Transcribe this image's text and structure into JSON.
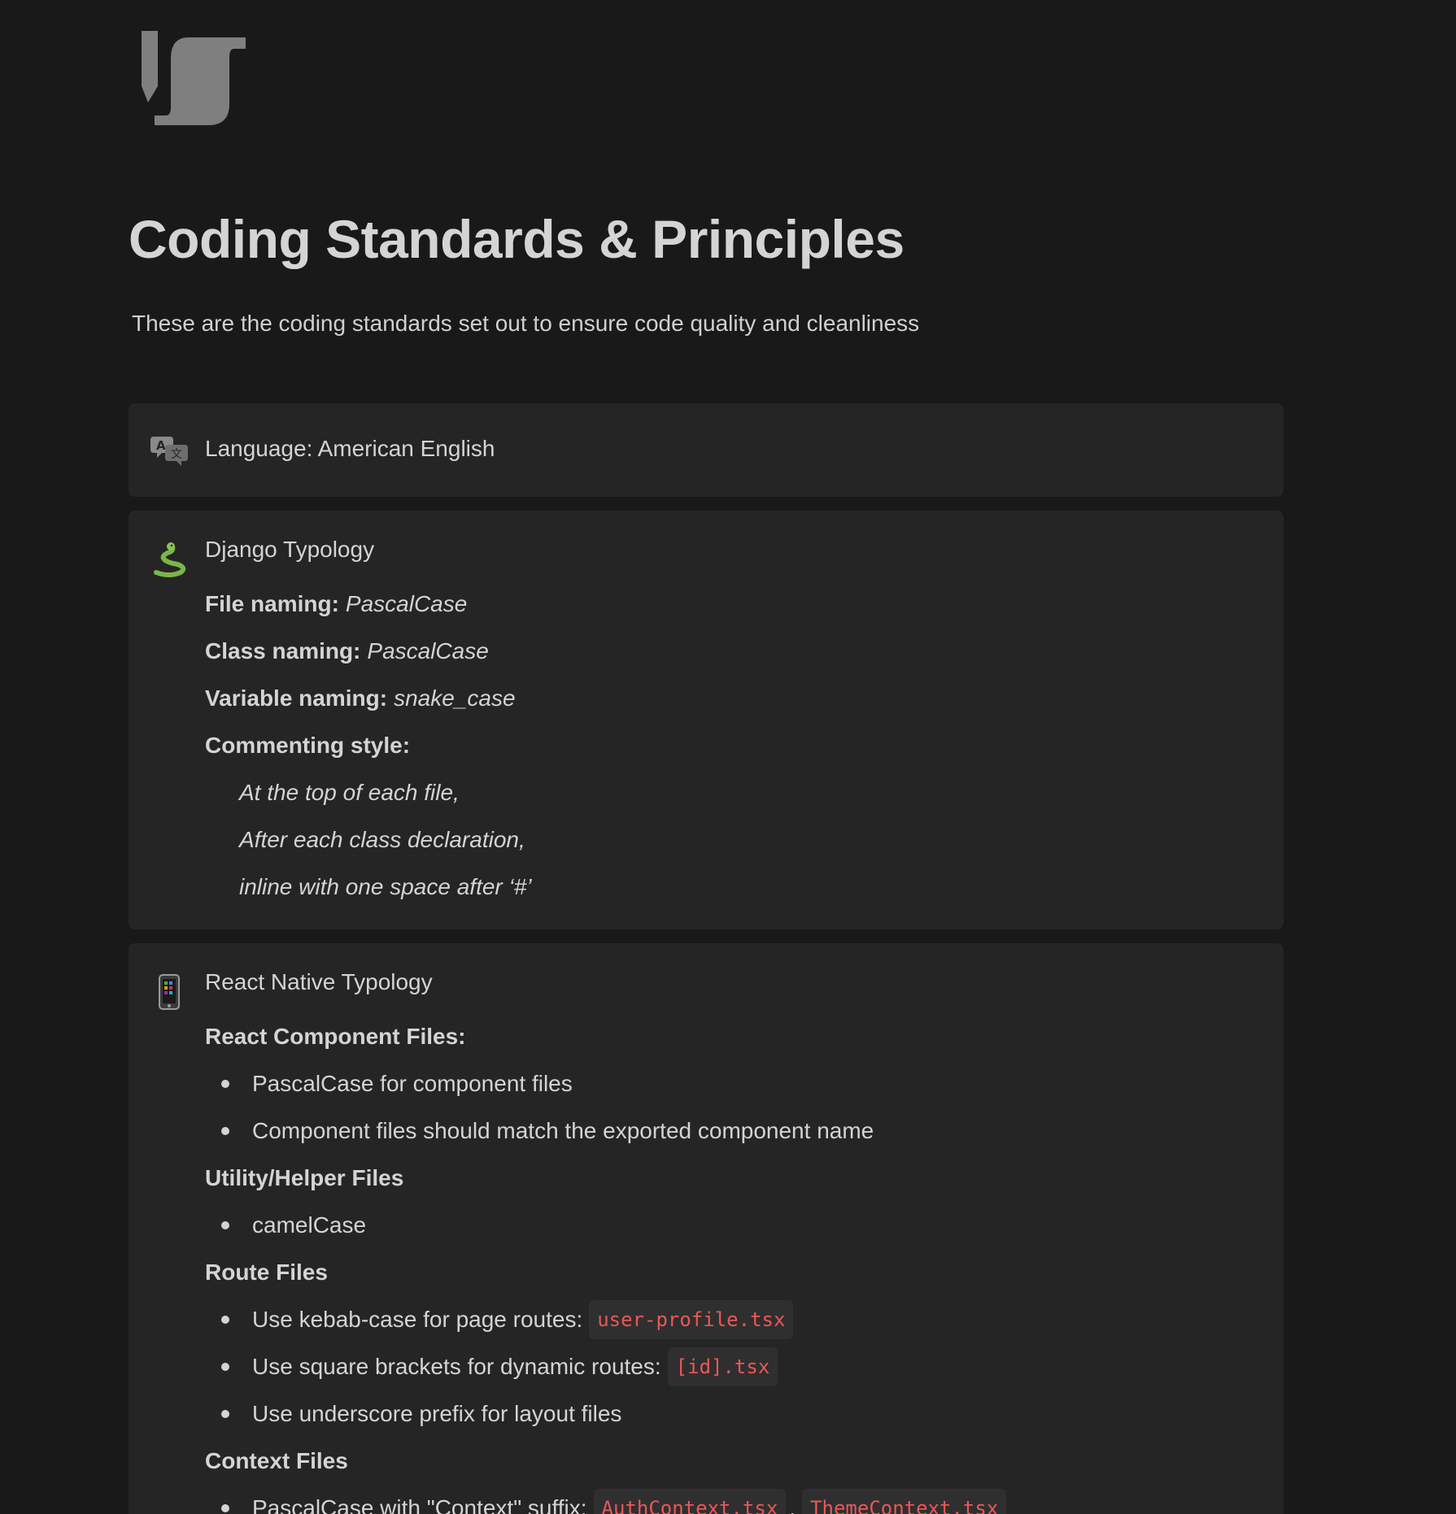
{
  "page": {
    "title": "Coding Standards & Principles",
    "subtitle": "These are the coding standards set out to ensure code quality and cleanliness"
  },
  "callouts": {
    "language": {
      "icon": "translate-icon",
      "text": "Language: American English"
    },
    "django": {
      "icon": "snake-icon",
      "title": "Django Typology",
      "rows": [
        {
          "label": "File naming:",
          "value": "PascalCase"
        },
        {
          "label": "Class naming:",
          "value": "PascalCase"
        },
        {
          "label": "Variable naming:",
          "value": "snake_case"
        },
        {
          "label": "Commenting style:",
          "value": ""
        }
      ],
      "comment_items": [
        "At the top of each file,",
        "After each class declaration,",
        "inline with one space after ‘#’"
      ]
    },
    "react_native": {
      "icon": "mobile-phone-icon",
      "title": "React Native Typology",
      "sections": {
        "components": {
          "heading": "React Component Files:",
          "items": [
            "PascalCase for component files",
            "Component files should match the exported component name"
          ]
        },
        "utility": {
          "heading": "Utility/Helper Files",
          "items": [
            "camelCase"
          ]
        },
        "routes": {
          "heading": "Route Files",
          "items": [
            {
              "text": "Use kebab-case for page routes:",
              "code": "user-profile.tsx"
            },
            {
              "text": "Use square brackets for dynamic routes:",
              "code": "[id].tsx"
            },
            {
              "text": "Use underscore prefix for layout files",
              "code": ""
            }
          ]
        },
        "context": {
          "heading": "Context Files",
          "items": [
            {
              "text": "PascalCase with \"Context\" suffix:",
              "code1": "AuthContext.tsx",
              "separator": ",",
              "code2": "ThemeContext.tsx"
            }
          ]
        }
      }
    }
  }
}
